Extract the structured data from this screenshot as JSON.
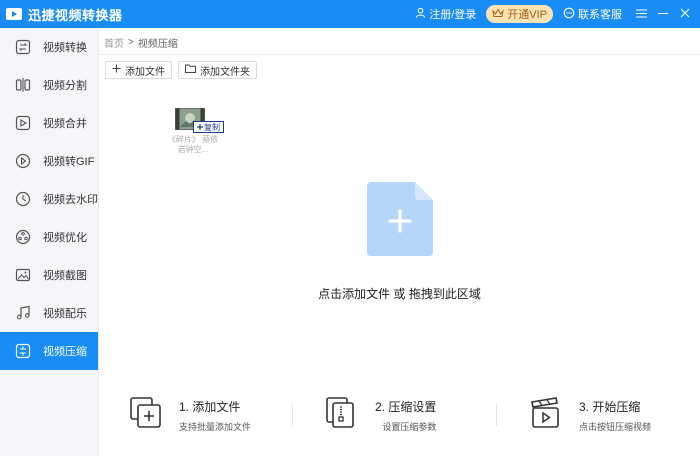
{
  "app": {
    "title": "迅捷视频转换器",
    "login_label": "注册/登录",
    "vip_label": "开通VIP",
    "service_label": "联系客服",
    "accent_color": "#1a8cf5"
  },
  "sidebar": {
    "items": [
      {
        "label": "视频转换",
        "icon": "video-convert-icon"
      },
      {
        "label": "视频分割",
        "icon": "video-split-icon"
      },
      {
        "label": "视频合并",
        "icon": "video-merge-icon"
      },
      {
        "label": "视频转GIF",
        "icon": "video-gif-icon"
      },
      {
        "label": "视频去水印",
        "icon": "watermark-icon"
      },
      {
        "label": "视频优化",
        "icon": "video-optimize-icon"
      },
      {
        "label": "视频截图",
        "icon": "screenshot-icon"
      },
      {
        "label": "视频配乐",
        "icon": "music-icon"
      },
      {
        "label": "视频压缩",
        "icon": "compress-icon",
        "active": true
      }
    ]
  },
  "breadcrumb": {
    "home": "首页",
    "separator": ">",
    "current": "视频压缩"
  },
  "toolbar": {
    "add_file": "添加文件",
    "add_folder": "添加文件夹"
  },
  "drag_item": {
    "badge": "复制",
    "caption_line1": "《碎片》 蔡依",
    "caption_line2": "岩钟空...",
    "icon": "video-file-icon"
  },
  "drop_zone": {
    "text": "点击添加文件 或 拖拽到此区域",
    "icon": "add-file-icon"
  },
  "steps": [
    {
      "title": "1. 添加文件",
      "desc": "支持批量添加文件",
      "icon": "add-file-step-icon"
    },
    {
      "title": "2. 压缩设置",
      "desc": "设置压缩参数",
      "icon": "compress-settings-icon"
    },
    {
      "title": "3. 开始压缩",
      "desc": "点击按钮压缩视频",
      "icon": "start-compress-icon"
    }
  ]
}
